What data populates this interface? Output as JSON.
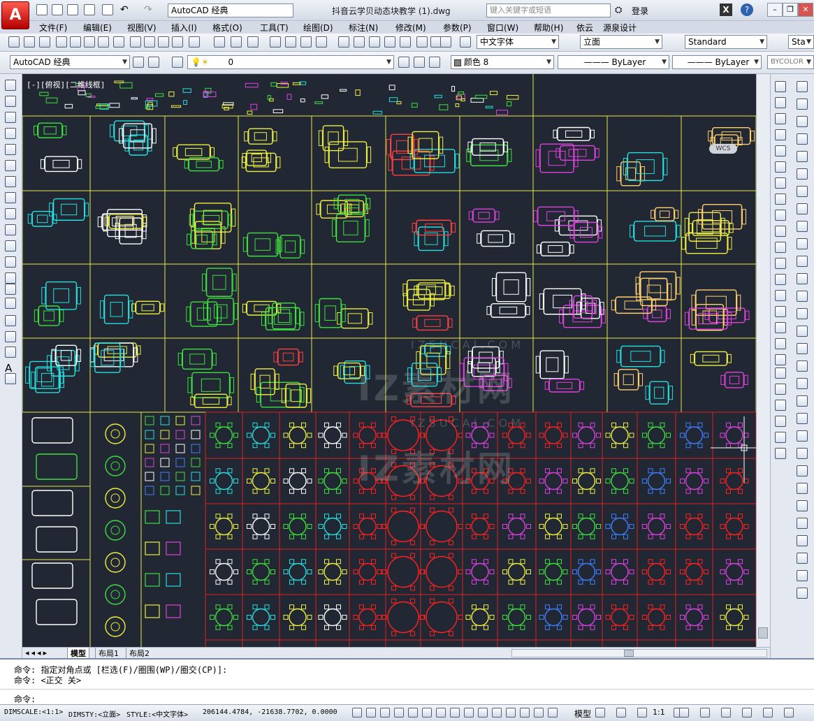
{
  "title_bar": {
    "app_logo": "A",
    "workspace": "AutoCAD 经典",
    "document_title": "抖音云学贝动态块教学 (1).dwg",
    "search_placeholder": "键入关键字或短语",
    "login_label": "登录",
    "help": "?"
  },
  "menu": [
    "文件(F)",
    "编辑(E)",
    "视图(V)",
    "插入(I)",
    "格式(O)",
    "工具(T)",
    "绘图(D)",
    "标注(N)",
    "修改(M)",
    "参数(P)",
    "窗口(W)",
    "帮助(H)",
    "依云",
    "源泉设计"
  ],
  "toolbar_std": {
    "text_style": "中文字体",
    "dim_style": "立面",
    "table_style": "Standard",
    "mleader_style": "Sta"
  },
  "toolbar_layers": {
    "workspace": "AutoCAD 经典",
    "layer": "0",
    "color": "颜色 8",
    "linetype": "ByLayer",
    "lineweight": "ByLayer",
    "plotstyle": "BYCOLOR"
  },
  "viewport": {
    "label": "[-][俯视][二维线框]",
    "wcs": "WCS",
    "watermark_main": "IZ素材网",
    "watermark_sub": "IZSUCAI.COM"
  },
  "tabs": [
    "模型",
    "布局1",
    "布局2"
  ],
  "command_lines": [
    "命令: 指定对角点或 [栏选(F)/圈围(WP)/圈交(CP)]:",
    "命令: <正交 关>",
    "命令:"
  ],
  "status": {
    "dimscale": "DIMSCALE:<1:1>",
    "dimsty": "DIMSTY:<立面>",
    "style": "STYLE:<中文字体>",
    "coords": "206144.4784, -21638.7702, 0.0000",
    "model_label": "模型",
    "scale": "1:1"
  },
  "colors": {
    "canvas": "#212833",
    "grid_yellow": "#e8e84a",
    "grid_red": "#e02020",
    "accent_blue": "#1b4a8c"
  }
}
